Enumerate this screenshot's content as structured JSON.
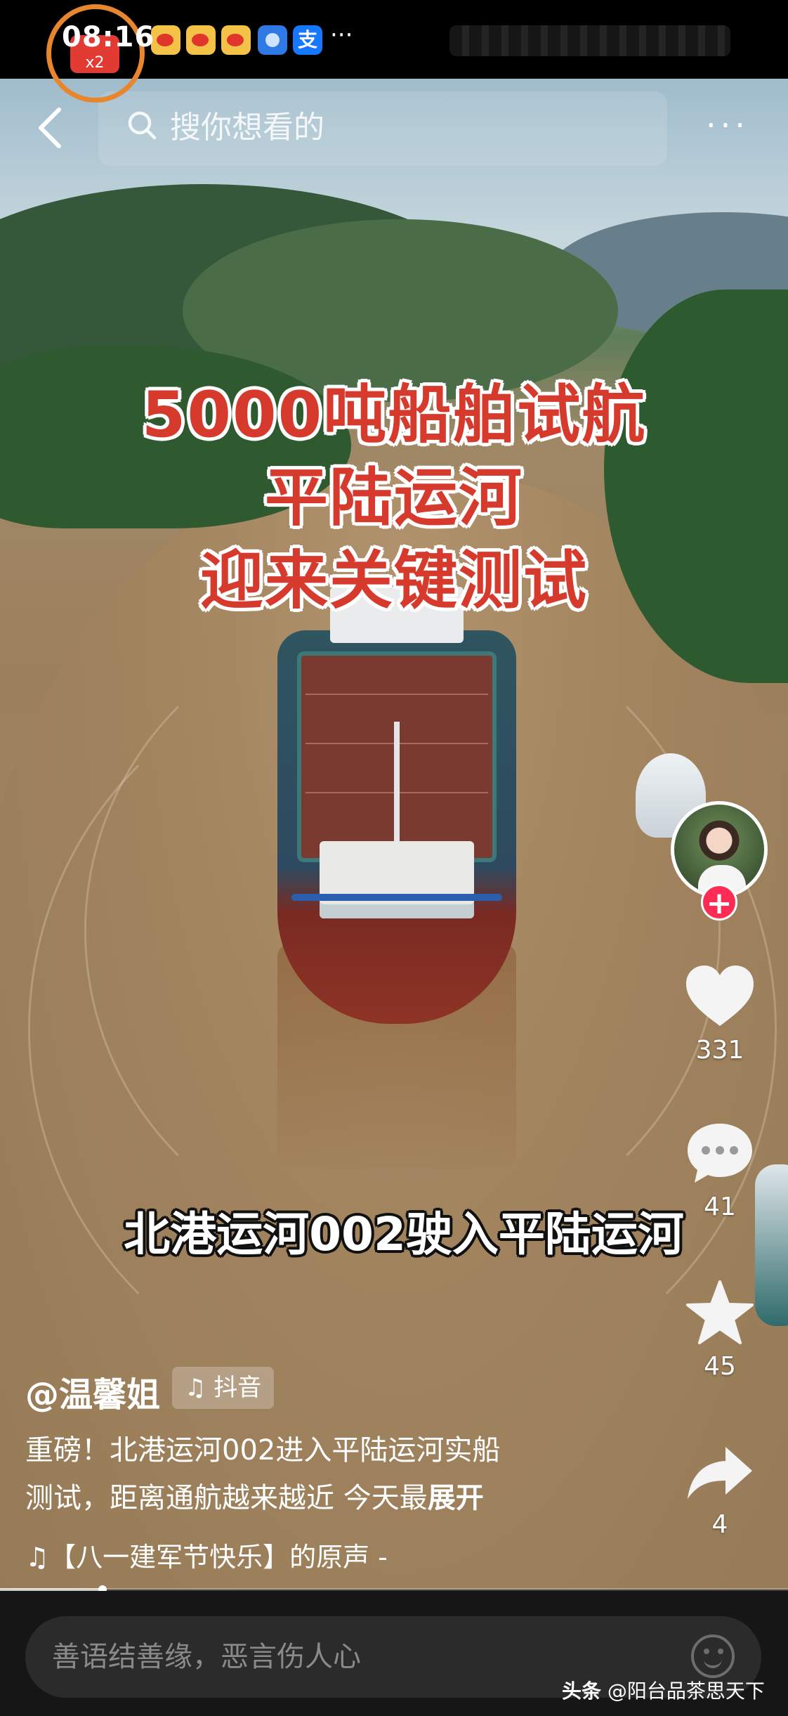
{
  "status_bar": {
    "time": "08:16",
    "recording_badge": "x2",
    "overflow": "···",
    "apps": [
      "weibo-icon",
      "weibo-icon",
      "weibo-icon",
      "browser-icon",
      "alipay-icon"
    ],
    "alipay_glyph": "支"
  },
  "top_bar": {
    "search_placeholder": "搜你想看的",
    "more": "···"
  },
  "video": {
    "title_lines": [
      "5000吨船舶试航",
      "平陆运河",
      "迎来关键测试"
    ],
    "caption": "北港运河002驶入平陆运河"
  },
  "side_rail": {
    "follow_symbol": "+",
    "like_count": "331",
    "comment_count": "41",
    "favorite_count": "45",
    "share_count": "4"
  },
  "info": {
    "author": "@温馨姐",
    "platform": "抖音",
    "description_line1": "重磅！北港运河002进入平陆运河实船",
    "description_line2": "测试，距离通航越来越近 今天最",
    "expand_label": "展开",
    "music": "【八一建军节快乐】的原声 -",
    "progress": 0.13
  },
  "comment_bar": {
    "placeholder": "善语结善缘，恶言伤人心"
  },
  "watermark": {
    "brand": "头条",
    "account": "@阳台品茶思天下"
  }
}
